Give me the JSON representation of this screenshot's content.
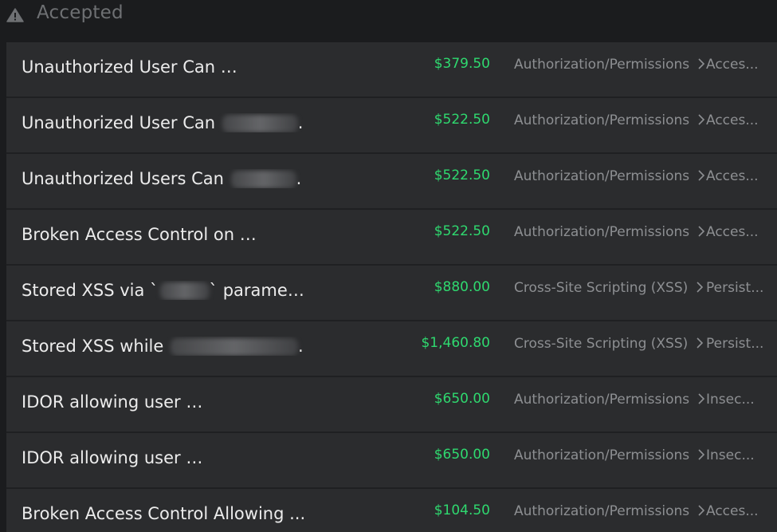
{
  "section": {
    "title": "Accepted",
    "icon": "collapse-triangle-icon"
  },
  "reports": [
    {
      "title_prefix": "Unauthorized User Can ",
      "redaction_w": 105,
      "title_suffix": ".",
      "amount": "$379.50",
      "category": "Authorization/Permissions",
      "subcategory": "Acces..."
    },
    {
      "title_prefix": "Unauthorized User Can ",
      "redaction_w": 95,
      "title_suffix": ".",
      "amount": "$522.50",
      "category": "Authorization/Permissions",
      "subcategory": "Acces..."
    },
    {
      "title_prefix": "Unauthorized Users Can ",
      "redaction_w": 82,
      "title_suffix": ".",
      "amount": "$522.50",
      "category": "Authorization/Permissions",
      "subcategory": "Acces..."
    },
    {
      "title_prefix": "Broken Access Control on ",
      "redaction_w": 78,
      "title_suffix": ".",
      "amount": "$522.50",
      "category": "Authorization/Permissions",
      "subcategory": "Acces..."
    },
    {
      "title_prefix": "Stored XSS via `",
      "redaction_w": 62,
      "title_suffix": "` paramet...",
      "amount": "$880.00",
      "category": "Cross-Site Scripting (XSS)",
      "subcategory": "Persist..."
    },
    {
      "title_prefix": "Stored XSS while ",
      "redaction_w": 160,
      "title_suffix": ".",
      "amount": "$1,460.80",
      "category": "Cross-Site Scripting (XSS)",
      "subcategory": "Persist..."
    },
    {
      "title_prefix": "IDOR allowing user ",
      "redaction_w": 150,
      "title_suffix": ".",
      "amount": "$650.00",
      "category": "Authorization/Permissions",
      "subcategory": "Insec..."
    },
    {
      "title_prefix": "IDOR allowing user ",
      "redaction_w": 145,
      "title_suffix": ".",
      "amount": "$650.00",
      "category": "Authorization/Permissions",
      "subcategory": "Insec..."
    },
    {
      "title_prefix": "Broken Access Control Allowing ...",
      "redaction_w": 0,
      "title_suffix": "",
      "amount": "$104.50",
      "category": "Authorization/Permissions",
      "subcategory": "Acces..."
    }
  ]
}
